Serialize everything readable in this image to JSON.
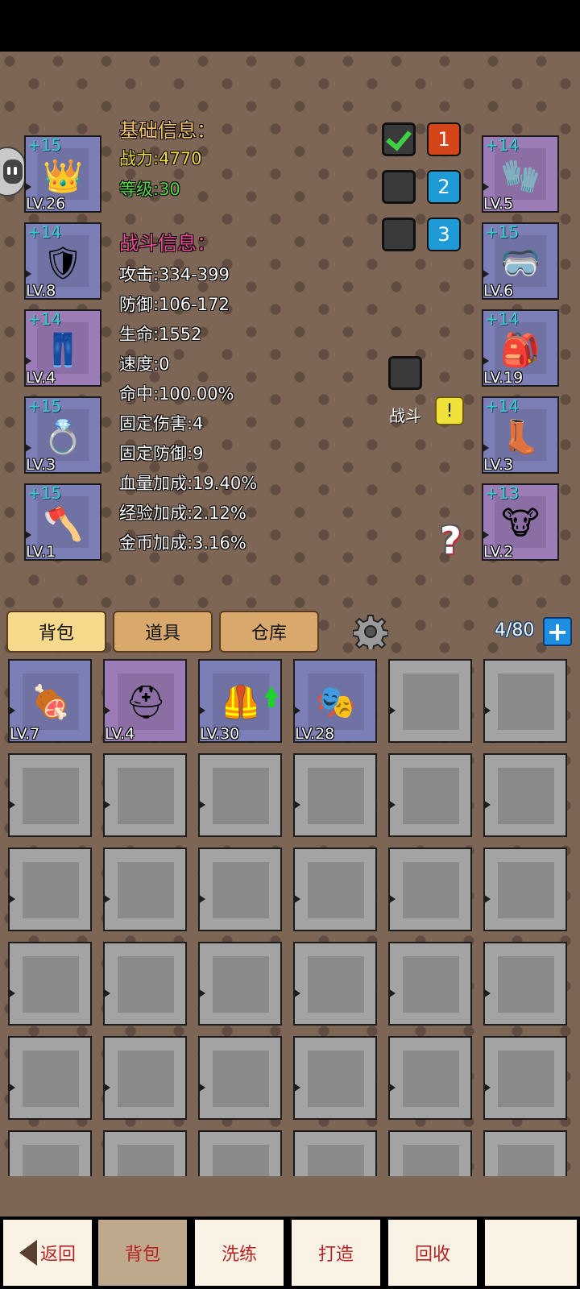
{
  "equipment_left": [
    {
      "plus": "+15",
      "lv": "LV.26",
      "color": "blue",
      "icon": "crown-icon"
    },
    {
      "plus": "+14",
      "lv": "LV.8",
      "color": "blue",
      "icon": "armor-icon"
    },
    {
      "plus": "+14",
      "lv": "LV.4",
      "color": "purple",
      "icon": "pants-icon"
    },
    {
      "plus": "+15",
      "lv": "LV.3",
      "color": "blue",
      "icon": "ring-icon"
    },
    {
      "plus": "+15",
      "lv": "LV.1",
      "color": "blue",
      "icon": "axe-icon"
    }
  ],
  "equipment_right": [
    {
      "plus": "+14",
      "lv": "LV.5",
      "color": "purple",
      "icon": "gloves-icon"
    },
    {
      "plus": "+15",
      "lv": "LV.6",
      "color": "blue",
      "icon": "goggles-icon"
    },
    {
      "plus": "+14",
      "lv": "LV.19",
      "color": "blue",
      "icon": "backpack-icon"
    },
    {
      "plus": "+14",
      "lv": "LV.3",
      "color": "blue",
      "icon": "boots-icon"
    },
    {
      "plus": "+13",
      "lv": "LV.2",
      "color": "purple",
      "icon": "amulet-icon"
    }
  ],
  "basic_info": {
    "heading": "基础信息：",
    "power": "战力:4770",
    "level": "等级:30"
  },
  "battle_info": {
    "heading": "战斗信息：",
    "lines": [
      "攻击:334-399",
      "防御:106-172",
      "生命:1552",
      "速度:0",
      "命中:100.00%",
      "固定伤害:4",
      "固定防御:9",
      "血量加成:19.40%",
      "经验加成:2.12%",
      "金币加成:3.16%"
    ]
  },
  "presets": [
    {
      "number": "1",
      "checked": true,
      "color": "#d4451c"
    },
    {
      "number": "2",
      "checked": false,
      "color": "#1e9ad6"
    },
    {
      "number": "3",
      "checked": false,
      "color": "#1e9ad6"
    }
  ],
  "battle_toggle": {
    "label": "战斗",
    "alert": "!"
  },
  "help_symbol": "?",
  "tabs": [
    {
      "label": "背包",
      "active": true
    },
    {
      "label": "道具",
      "active": false
    },
    {
      "label": "仓库",
      "active": false
    }
  ],
  "capacity": "4/80",
  "add_symbol": "+",
  "inventory": [
    {
      "lv": "LV.7",
      "color": "blue",
      "icon": "meat-icon"
    },
    {
      "lv": "LV.4",
      "color": "purple",
      "icon": "helmet-icon"
    },
    {
      "lv": "LV.30",
      "color": "blue",
      "icon": "dark-armor-icon",
      "upgrade": true
    },
    {
      "lv": "LV.28",
      "color": "blue",
      "icon": "mask-icon"
    }
  ],
  "footer": {
    "back": "返回",
    "buttons": [
      "背包",
      "洗练",
      "打造",
      "回收",
      ""
    ]
  }
}
